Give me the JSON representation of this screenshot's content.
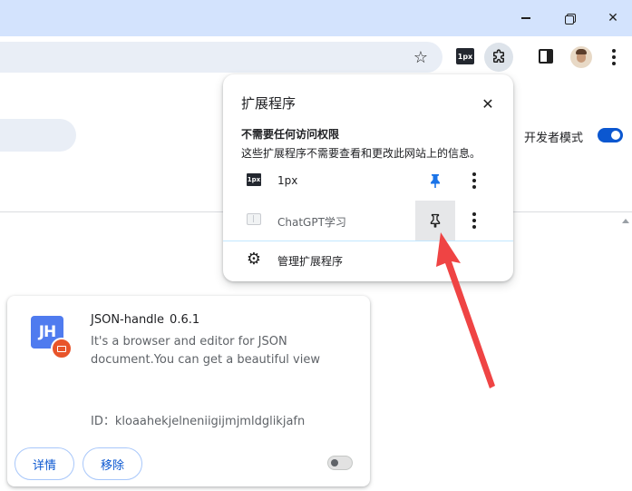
{
  "window": {
    "minimize_label": "",
    "restore_label": "",
    "close_label": "✕"
  },
  "toolbar": {
    "pinned_extension_badge": "1px",
    "icons": [
      "star-icon",
      "puzzle-icon",
      "side-panel-icon",
      "avatar",
      "more-icon"
    ]
  },
  "page": {
    "developer_mode_label": "开发者模式",
    "developer_mode_enabled": true
  },
  "extension_card": {
    "icon_text": "JH",
    "name": "JSON-handle",
    "version": "0.6.1",
    "description": "It's a browser and editor for JSON document.You can get a beautiful view",
    "id_line": "ID：kloaahekjelneniigijmjmldglikjafn",
    "details_button": "详情",
    "remove_button": "移除",
    "enabled": false
  },
  "popup": {
    "title": "扩展程序",
    "section_heading": "不需要任何访问权限",
    "section_description": "这些扩展程序不需要查看和更改此网站上的信息。",
    "extensions": [
      {
        "icon_text": "1px",
        "name": "1px",
        "pinned": true
      },
      {
        "icon_text": "",
        "name": "ChatGPT学习",
        "pinned": false
      }
    ],
    "manage_label": "管理扩展程序"
  },
  "colors": {
    "titlebar": "#d3e3fd",
    "accent_blue": "#0b57d0",
    "pin_blue": "#1a73e8",
    "annotation_red": "#ef4444"
  }
}
